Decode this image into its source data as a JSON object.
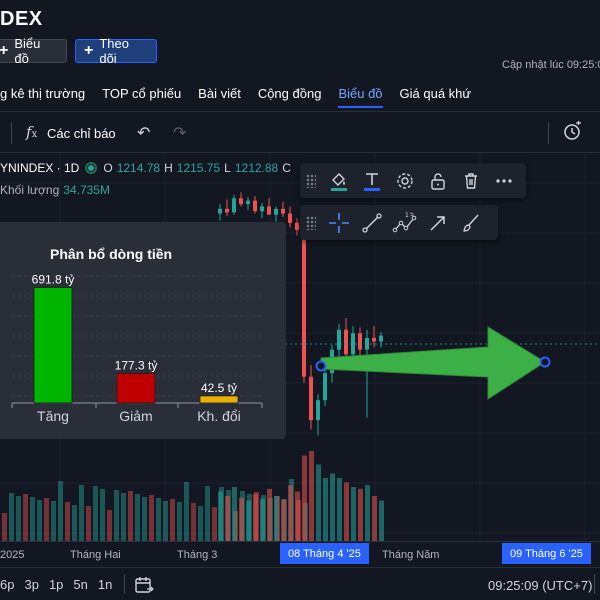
{
  "header": {
    "title": "DEX",
    "chart_button": "Biểu đồ",
    "follow_button": "Theo dõi",
    "update_label": "Cập nhật lúc  09:25:0"
  },
  "nav": {
    "items": [
      {
        "label": "g kê thị trường",
        "active": false
      },
      {
        "label": "TOP cổ phiếu",
        "active": false
      },
      {
        "label": "Bài viết",
        "active": false
      },
      {
        "label": "Cộng đồng",
        "active": false
      },
      {
        "label": "Biểu đồ",
        "active": true
      },
      {
        "label": "Giá quá khứ",
        "active": false
      }
    ]
  },
  "toolbar": {
    "indicators_label": "Các chỉ báo"
  },
  "legend": {
    "symbol": "YNINDEX · 1D",
    "open_key": "O",
    "open": "1214.78",
    "high_key": "H",
    "high": "1215.75",
    "low_key": "L",
    "low": "1212.88",
    "extra_key": "C",
    "volume_label": "Khối lượng",
    "volume_value": "34.735M"
  },
  "draw_toolbar": {
    "icons": [
      "fill-bucket-icon",
      "text-color-icon",
      "gear-icon",
      "unlock-icon",
      "trash-icon",
      "more-icon"
    ],
    "fill_color": "#26a69a",
    "text_color": "#2962ff"
  },
  "line_toolbar": {
    "icons": [
      "crosshair-icon",
      "trend-line-icon",
      "wave-pattern-icon",
      "arrow-icon",
      "brush-icon"
    ]
  },
  "flow_popup": {
    "title": "Phân bổ dòng tiền",
    "chart_data": {
      "type": "bar",
      "title": "Phân bổ dòng tiền",
      "categories": [
        "Tăng",
        "Giảm",
        "Kh. đổi"
      ],
      "values": [
        691.8,
        177.3,
        42.5
      ],
      "value_labels": [
        "691.8 tỷ",
        "177.3 tỷ",
        "42.5 tỷ"
      ],
      "colors": [
        "#00b400",
        "#c00000",
        "#e8b300"
      ],
      "ylim": [
        0,
        760
      ],
      "grid": true
    }
  },
  "price_chart": {
    "chart_data": {
      "type": "candlestick",
      "candles": [
        {
          "o": 1244,
          "h": 1252,
          "l": 1238,
          "c": 1248,
          "v": 0.55
        },
        {
          "o": 1248,
          "h": 1256,
          "l": 1242,
          "c": 1245,
          "v": 0.5
        },
        {
          "o": 1245,
          "h": 1260,
          "l": 1243,
          "c": 1257,
          "v": 0.6
        },
        {
          "o": 1257,
          "h": 1262,
          "l": 1250,
          "c": 1252,
          "v": 0.48
        },
        {
          "o": 1252,
          "h": 1258,
          "l": 1247,
          "c": 1255,
          "v": 0.45
        },
        {
          "o": 1255,
          "h": 1259,
          "l": 1244,
          "c": 1246,
          "v": 0.52
        },
        {
          "o": 1246,
          "h": 1253,
          "l": 1240,
          "c": 1250,
          "v": 0.47
        },
        {
          "o": 1250,
          "h": 1257,
          "l": 1245,
          "c": 1243,
          "v": 0.58
        },
        {
          "o": 1243,
          "h": 1250,
          "l": 1237,
          "c": 1248,
          "v": 0.5
        },
        {
          "o": 1248,
          "h": 1254,
          "l": 1241,
          "c": 1244,
          "v": 0.46
        },
        {
          "o": 1244,
          "h": 1250,
          "l": 1232,
          "c": 1236,
          "v": 0.62
        },
        {
          "o": 1236,
          "h": 1240,
          "l": 1225,
          "c": 1230,
          "v": 0.55
        },
        {
          "o": 1228,
          "h": 1232,
          "l": 1100,
          "c": 1105,
          "v": 0.95
        },
        {
          "o": 1105,
          "h": 1115,
          "l": 1060,
          "c": 1068,
          "v": 1.0
        },
        {
          "o": 1068,
          "h": 1090,
          "l": 1055,
          "c": 1085,
          "v": 0.85
        },
        {
          "o": 1085,
          "h": 1112,
          "l": 1080,
          "c": 1108,
          "v": 0.7
        },
        {
          "o": 1108,
          "h": 1132,
          "l": 1100,
          "c": 1128,
          "v": 0.75
        },
        {
          "o": 1128,
          "h": 1150,
          "l": 1120,
          "c": 1145,
          "v": 0.7
        },
        {
          "o": 1145,
          "h": 1155,
          "l": 1118,
          "c": 1124,
          "v": 0.65
        },
        {
          "o": 1124,
          "h": 1148,
          "l": 1120,
          "c": 1142,
          "v": 0.6
        },
        {
          "o": 1142,
          "h": 1147,
          "l": 1122,
          "c": 1128,
          "v": 0.58
        },
        {
          "o": 1128,
          "h": 1145,
          "l": 1070,
          "c": 1138,
          "v": 0.62
        },
        {
          "o": 1138,
          "h": 1148,
          "l": 1130,
          "c": 1135,
          "v": 0.5
        },
        {
          "o": 1135,
          "h": 1143,
          "l": 1130,
          "c": 1140,
          "v": 0.45
        }
      ],
      "ylim": [
        1040,
        1270
      ],
      "xticks": [
        "2025",
        "Tháng Hai",
        "Tháng 3",
        "Tháng Năm"
      ],
      "highlighted_ticks": [
        "08 Tháng 4 '25",
        "09 Tháng 6 '25"
      ],
      "up_color": "#26a69a",
      "down_color": "#ef5350"
    }
  },
  "bottom_bar": {
    "periods": [
      "6p",
      "3p",
      "1p",
      "5n",
      "1n"
    ],
    "time": "09:25:09 (UTC+7)"
  }
}
